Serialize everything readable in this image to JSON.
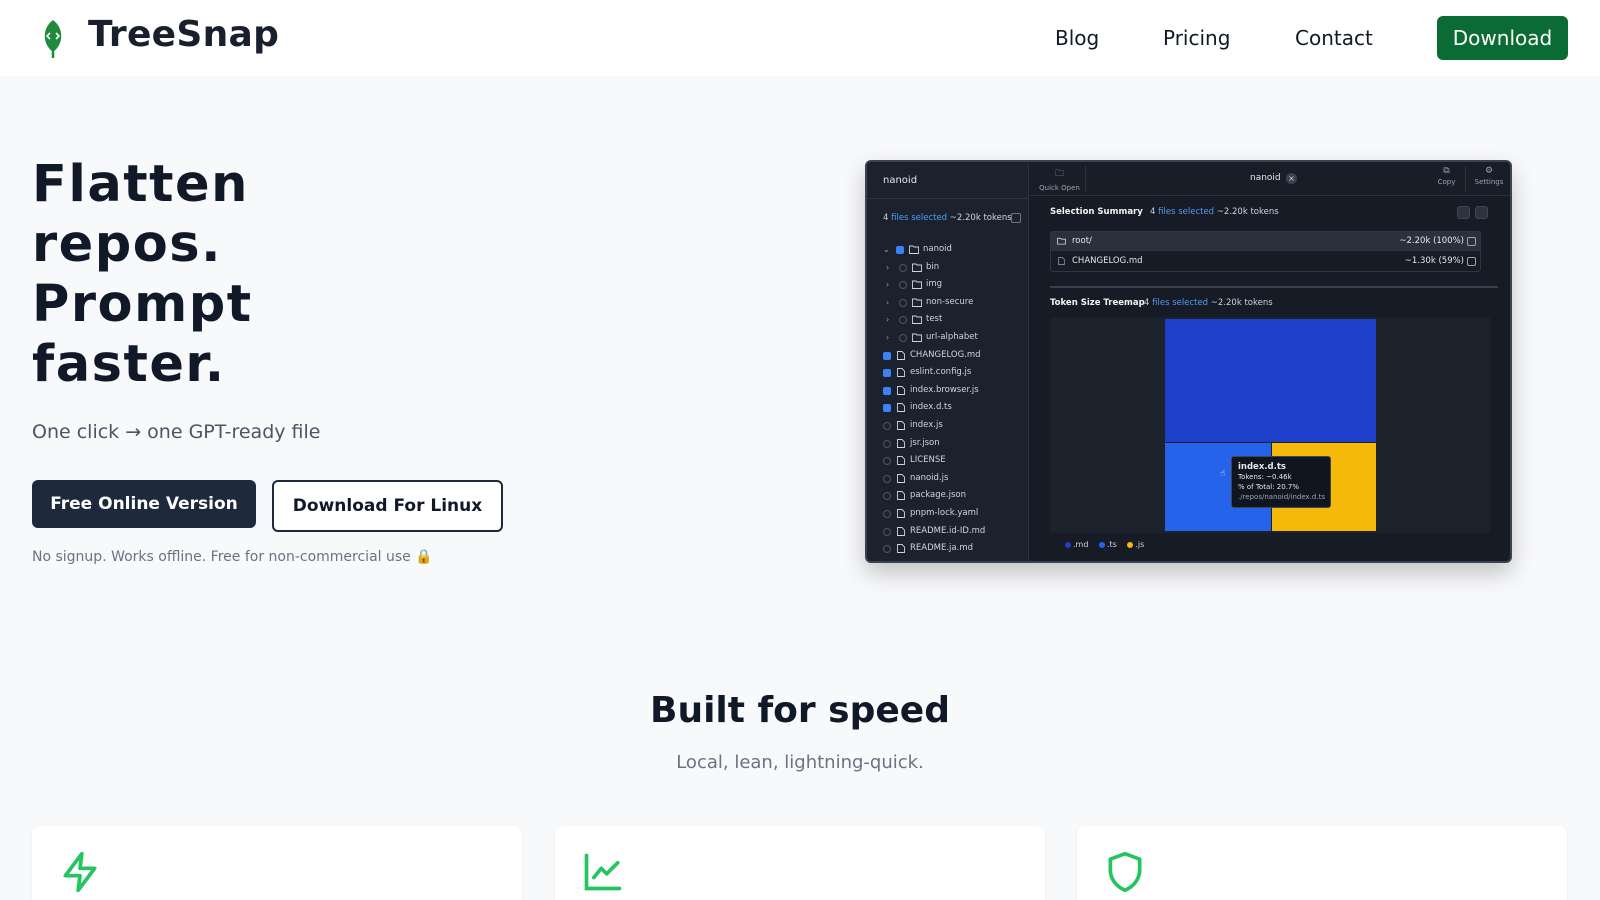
{
  "header": {
    "brand": "TreeSnap",
    "nav": [
      {
        "label": "Blog"
      },
      {
        "label": "Pricing"
      },
      {
        "label": "Contact"
      }
    ],
    "download_label": "Download"
  },
  "hero": {
    "title_lines": [
      "Flatten",
      "repos.",
      "Prompt",
      "faster."
    ],
    "subtitle": "One click → one GPT-ready file",
    "primary_button": "Free Online Version",
    "secondary_button": "Download For Linux",
    "note": "No signup. Works offline. Free for non-commercial use 🔒"
  },
  "app_preview": {
    "sidebar": {
      "title": "nanoid",
      "selection": {
        "count": "4",
        "files_selected": "files selected",
        "tokens": "~2.20k tokens"
      },
      "tree": [
        {
          "label": "nanoid",
          "type": "folder",
          "checked": true,
          "expanded": true,
          "depth": 0
        },
        {
          "label": "bin",
          "type": "folder",
          "checked": false,
          "depth": 1
        },
        {
          "label": "img",
          "type": "folder",
          "checked": false,
          "depth": 1
        },
        {
          "label": "non-secure",
          "type": "folder",
          "checked": false,
          "depth": 1
        },
        {
          "label": "test",
          "type": "folder",
          "checked": false,
          "depth": 1
        },
        {
          "label": "url-alphabet",
          "type": "folder",
          "checked": false,
          "depth": 1
        },
        {
          "label": "CHANGELOG.md",
          "type": "file",
          "checked": true
        },
        {
          "label": "eslint.config.js",
          "type": "file",
          "checked": true
        },
        {
          "label": "index.browser.js",
          "type": "file",
          "checked": true
        },
        {
          "label": "index.d.ts",
          "type": "file",
          "checked": true
        },
        {
          "label": "index.js",
          "type": "file",
          "checked": false
        },
        {
          "label": "jsr.json",
          "type": "file",
          "checked": false
        },
        {
          "label": "LICENSE",
          "type": "file",
          "checked": false
        },
        {
          "label": "nanoid.js",
          "type": "file",
          "checked": false
        },
        {
          "label": "package.json",
          "type": "file",
          "checked": false
        },
        {
          "label": "pnpm-lock.yaml",
          "type": "file",
          "checked": false
        },
        {
          "label": "README.id-ID.md",
          "type": "file",
          "checked": false
        },
        {
          "label": "README.ja.md",
          "type": "file",
          "checked": false
        }
      ]
    },
    "topbar": {
      "quick_open": "Quick Open",
      "tab_name": "nanoid",
      "copy": "Copy",
      "settings": "Settings"
    },
    "summary": {
      "title": "Selection Summary",
      "count": "4",
      "files_selected": "files selected",
      "tokens": "~2.20k tokens",
      "rows": [
        {
          "name": "root/",
          "value": "~2.20k (100%)"
        },
        {
          "name": "CHANGELOG.md",
          "value": "~1.30k (59%)"
        }
      ]
    },
    "treemap": {
      "title": "Token Size Treemap",
      "count": "4",
      "files_selected": "files selected",
      "tokens": "~2.20k tokens",
      "colors": {
        "md": "#1d3fc9",
        "ts": "#2563eb",
        "js": "#f5b90a"
      },
      "tooltip": {
        "title": "index.d.ts",
        "tokens": "Tokens: ~0.46k",
        "percent": "% of Total: 20.7%",
        "path": "./repos/nanoid/index.d.ts"
      },
      "legend": [
        ".md",
        ".ts",
        ".js"
      ]
    }
  },
  "speed": {
    "title": "Built for speed",
    "subtitle": "Local, lean, lightning-quick."
  },
  "cards": [
    {
      "icon": "lightning-icon"
    },
    {
      "icon": "chart-line-icon"
    },
    {
      "icon": "shield-icon"
    }
  ],
  "colors": {
    "accent_green": "#0b6b34",
    "icon_green": "#22c55e",
    "dark_button": "#1e293b"
  }
}
